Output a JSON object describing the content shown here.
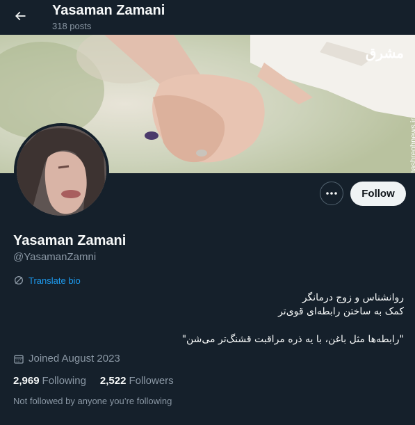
{
  "header": {
    "title": "Yasaman Zamani",
    "posts_count": "318 posts"
  },
  "banner": {
    "watermark_logo": "مشرق",
    "watermark_url": "mashreghnews.ir"
  },
  "actions": {
    "follow_label": "Follow",
    "more_label": "•••"
  },
  "profile": {
    "name": "Yasaman Zamani",
    "handle": "@YasamanZamni",
    "translate_label": "Translate bio",
    "bio_lines": [
      "روانشناس و زوج درمانگر",
      "کمک به ساختن رابطه‌ای قوی‌تر",
      "",
      "\"رابطه‌ها مثل باغن، با یه ذره مراقبت قشنگ‌تر می‌شن\""
    ],
    "joined": "Joined August 2023",
    "following_count": "2,969",
    "following_label": "Following",
    "followers_count": "2,522",
    "followers_label": "Followers",
    "not_followed_text": "Not followed by anyone you’re following"
  },
  "colors": {
    "background": "#15202b",
    "link": "#1d9bf0",
    "muted": "#8b98a5",
    "follow_button_bg": "#eff3f4"
  }
}
